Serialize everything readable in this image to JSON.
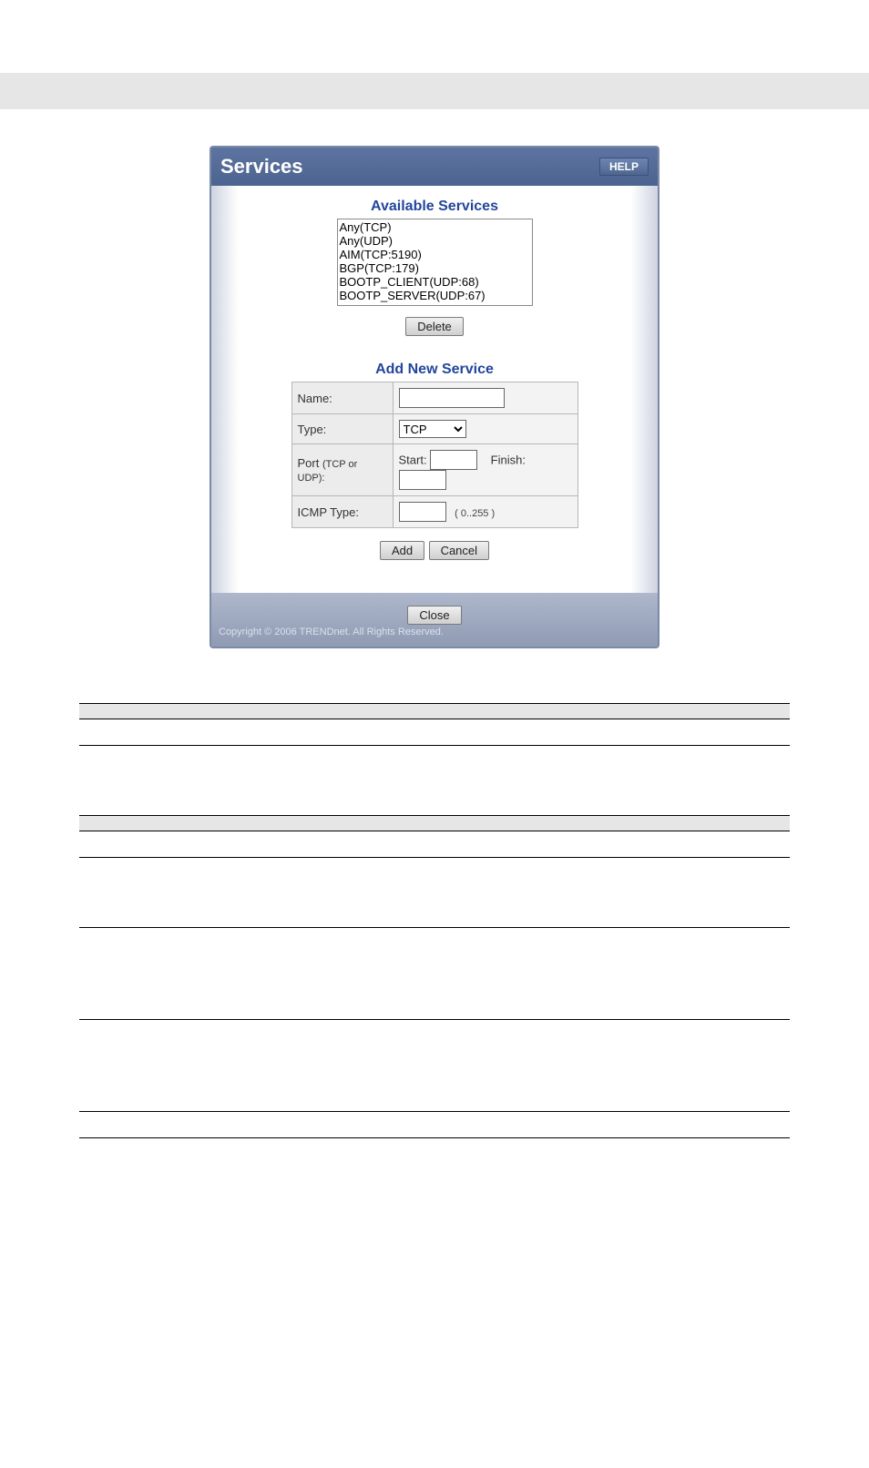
{
  "dialog": {
    "title": "Services",
    "help_label": "HELP",
    "available_title": "Available Services",
    "services_list": [
      "Any(TCP)",
      "Any(UDP)",
      "AIM(TCP:5190)",
      "BGP(TCP:179)",
      "BOOTP_CLIENT(UDP:68)",
      "BOOTP_SERVER(UDP:67)"
    ],
    "delete_label": "Delete",
    "add_title": "Add New Service",
    "form": {
      "name_label": "Name:",
      "type_label": "Type:",
      "type_value": "TCP",
      "port_label": "Port",
      "port_sub": "(TCP or UDP):",
      "start_label": "Start:",
      "finish_label": "Finish:",
      "icmp_label": "ICMP Type:",
      "icmp_hint": "( 0..255 )"
    },
    "add_btn": "Add",
    "cancel_btn": "Cancel",
    "close_btn": "Close",
    "copyright": "Copyright © 2006 TRENDnet. All Rights Reserved."
  },
  "table": {
    "sec1": "",
    "r1c1": "",
    "r1c2": "",
    "r2c1": "",
    "r2c2": "",
    "sec2": "",
    "r3c1": "",
    "r3c2": "",
    "r4c1": "",
    "r4c2": "",
    "r5c1": "",
    "r5c2": "",
    "r6c1": "",
    "r6c2": "",
    "r7c1": "",
    "r7c2": ""
  }
}
